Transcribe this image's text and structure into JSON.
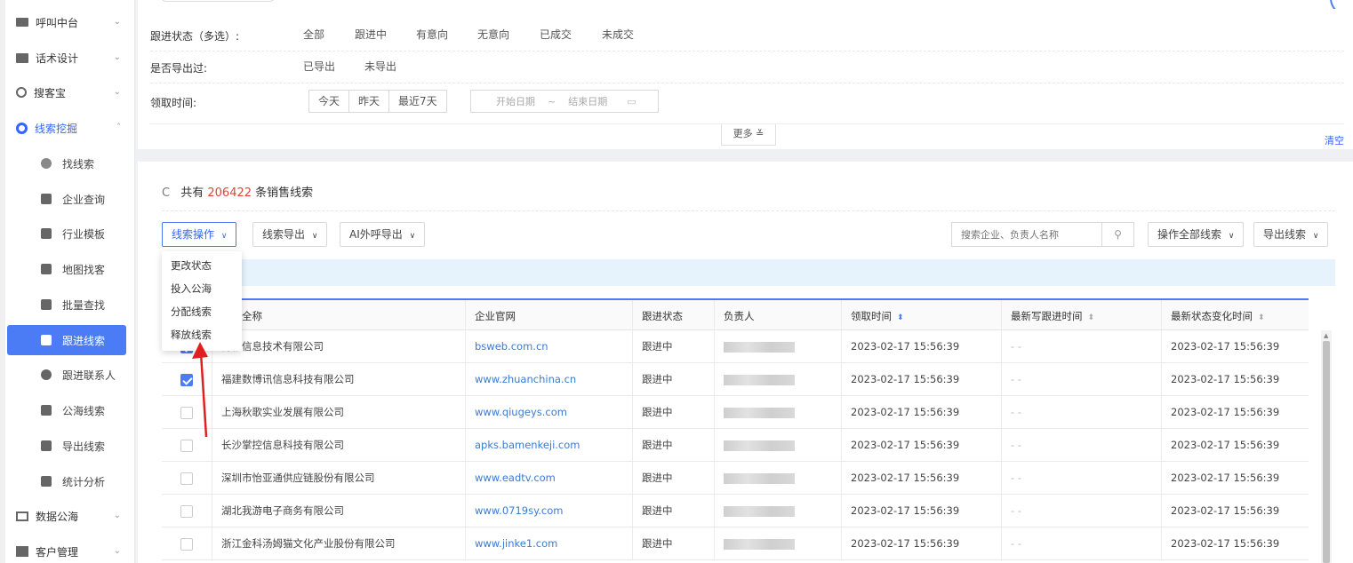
{
  "sidebar": {
    "top_items": [
      {
        "label": "呼叫中台",
        "icon": "monitor-icon"
      },
      {
        "label": "话术设计",
        "icon": "script-icon"
      },
      {
        "label": "搜客宝",
        "icon": "search-icon"
      },
      {
        "label": "线索挖掘",
        "icon": "target-icon"
      }
    ],
    "sub_items": [
      {
        "label": "找线索"
      },
      {
        "label": "企业查询"
      },
      {
        "label": "行业模板"
      },
      {
        "label": "地图找客"
      },
      {
        "label": "批量查找"
      },
      {
        "label": "跟进线索"
      },
      {
        "label": "跟进联系人"
      },
      {
        "label": "公海线索"
      },
      {
        "label": "导出线索"
      },
      {
        "label": "统计分析"
      }
    ],
    "bottom_items": [
      {
        "label": "数据公海"
      },
      {
        "label": "客户管理"
      }
    ]
  },
  "filters": {
    "status_label": "跟进状态（多选）:",
    "status_options": [
      "全部",
      "跟进中",
      "有意向",
      "无意向",
      "已成交",
      "未成交"
    ],
    "exported_label": "是否导出过:",
    "exported_options": [
      "已导出",
      "未导出"
    ],
    "time_label": "领取时间:",
    "time_buttons": [
      "今天",
      "昨天",
      "最近7天"
    ],
    "start_placeholder": "开始日期",
    "range_sep": "~",
    "end_placeholder": "结束日期",
    "more": "更多 ≚",
    "clear": "清空"
  },
  "list": {
    "total_prefix": "共有",
    "total_count": "206422",
    "total_suffix": "条销售线索",
    "toolbar": {
      "lead_ops": "线索操作",
      "lead_export": "线索导出",
      "ai_export": "AI外呼导出",
      "search_placeholder": "搜索企业、负责人名称",
      "op_all": "操作全部线索",
      "export_leads": "导出线索"
    },
    "dropdown": [
      "更改状态",
      "投入公海",
      "分配线索",
      "释放线索"
    ],
    "columns": [
      "企业全称",
      "企业官网",
      "跟进状态",
      "负责人",
      "领取时间",
      "最新写跟进时间",
      "最新状态变化时间"
    ],
    "rows": [
      {
        "company": "博杉信息技术有限公司",
        "site": "bsweb.com.cn",
        "status": "跟进中",
        "time": "2023-02-17 15:56:39",
        "last": "- -",
        "change": "2023-02-17 15:56:39",
        "checked": true
      },
      {
        "company": "福建数博讯信息科技有限公司",
        "site": "www.zhuanchina.cn",
        "status": "跟进中",
        "time": "2023-02-17 15:56:39",
        "last": "- -",
        "change": "2023-02-17 15:56:39",
        "checked": true
      },
      {
        "company": "上海秋歌实业发展有限公司",
        "site": "www.qiugeys.com",
        "status": "跟进中",
        "time": "2023-02-17 15:56:39",
        "last": "- -",
        "change": "2023-02-17 15:56:39",
        "checked": false
      },
      {
        "company": "长沙掌控信息科技有限公司",
        "site": "apks.bamenkeji.com",
        "status": "跟进中",
        "time": "2023-02-17 15:56:39",
        "last": "- -",
        "change": "2023-02-17 15:56:39",
        "checked": false
      },
      {
        "company": "深圳市怡亚通供应链股份有限公司",
        "site": "www.eadtv.com",
        "status": "跟进中",
        "time": "2023-02-17 15:56:39",
        "last": "- -",
        "change": "2023-02-17 15:56:39",
        "checked": false
      },
      {
        "company": "湖北我游电子商务有限公司",
        "site": "www.0719sy.com",
        "status": "跟进中",
        "time": "2023-02-17 15:56:39",
        "last": "- -",
        "change": "2023-02-17 15:56:39",
        "checked": false
      },
      {
        "company": "浙江金科汤姆猫文化产业股份有限公司",
        "site": "www.jinke1.com",
        "status": "跟进中",
        "time": "2023-02-17 15:56:39",
        "last": "- -",
        "change": "2023-02-17 15:56:39",
        "checked": false
      }
    ]
  },
  "colors": {
    "accent": "#4b7cf5",
    "link": "#3a7bd5",
    "count": "#e0433a",
    "arrow": "#e02020"
  }
}
